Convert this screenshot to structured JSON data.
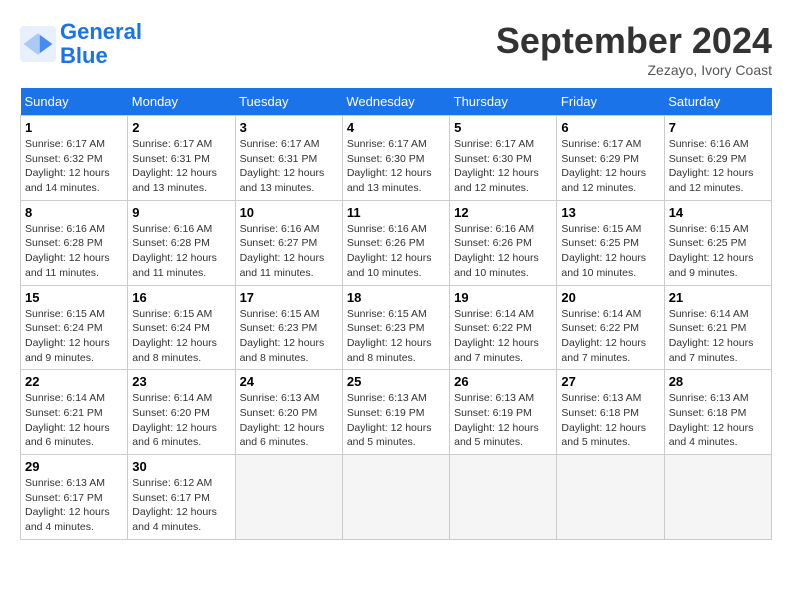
{
  "header": {
    "logo_line1": "General",
    "logo_line2": "Blue",
    "month": "September 2024",
    "location": "Zezayo, Ivory Coast"
  },
  "weekdays": [
    "Sunday",
    "Monday",
    "Tuesday",
    "Wednesday",
    "Thursday",
    "Friday",
    "Saturday"
  ],
  "days": [
    {
      "date": "",
      "info": ""
    },
    {
      "date": "",
      "info": ""
    },
    {
      "date": "",
      "info": ""
    },
    {
      "date": "",
      "info": ""
    },
    {
      "date": "",
      "info": ""
    },
    {
      "date": "",
      "info": ""
    },
    {
      "date": "1",
      "info": "Sunrise: 6:17 AM\nSunset: 6:32 PM\nDaylight: 12 hours\nand 14 minutes."
    },
    {
      "date": "2",
      "info": "Sunrise: 6:17 AM\nSunset: 6:31 PM\nDaylight: 12 hours\nand 13 minutes."
    },
    {
      "date": "3",
      "info": "Sunrise: 6:17 AM\nSunset: 6:31 PM\nDaylight: 12 hours\nand 13 minutes."
    },
    {
      "date": "4",
      "info": "Sunrise: 6:17 AM\nSunset: 6:30 PM\nDaylight: 12 hours\nand 13 minutes."
    },
    {
      "date": "5",
      "info": "Sunrise: 6:17 AM\nSunset: 6:30 PM\nDaylight: 12 hours\nand 12 minutes."
    },
    {
      "date": "6",
      "info": "Sunrise: 6:17 AM\nSunset: 6:29 PM\nDaylight: 12 hours\nand 12 minutes."
    },
    {
      "date": "7",
      "info": "Sunrise: 6:16 AM\nSunset: 6:29 PM\nDaylight: 12 hours\nand 12 minutes."
    },
    {
      "date": "8",
      "info": "Sunrise: 6:16 AM\nSunset: 6:28 PM\nDaylight: 12 hours\nand 11 minutes."
    },
    {
      "date": "9",
      "info": "Sunrise: 6:16 AM\nSunset: 6:28 PM\nDaylight: 12 hours\nand 11 minutes."
    },
    {
      "date": "10",
      "info": "Sunrise: 6:16 AM\nSunset: 6:27 PM\nDaylight: 12 hours\nand 11 minutes."
    },
    {
      "date": "11",
      "info": "Sunrise: 6:16 AM\nSunset: 6:26 PM\nDaylight: 12 hours\nand 10 minutes."
    },
    {
      "date": "12",
      "info": "Sunrise: 6:16 AM\nSunset: 6:26 PM\nDaylight: 12 hours\nand 10 minutes."
    },
    {
      "date": "13",
      "info": "Sunrise: 6:15 AM\nSunset: 6:25 PM\nDaylight: 12 hours\nand 10 minutes."
    },
    {
      "date": "14",
      "info": "Sunrise: 6:15 AM\nSunset: 6:25 PM\nDaylight: 12 hours\nand 9 minutes."
    },
    {
      "date": "15",
      "info": "Sunrise: 6:15 AM\nSunset: 6:24 PM\nDaylight: 12 hours\nand 9 minutes."
    },
    {
      "date": "16",
      "info": "Sunrise: 6:15 AM\nSunset: 6:24 PM\nDaylight: 12 hours\nand 8 minutes."
    },
    {
      "date": "17",
      "info": "Sunrise: 6:15 AM\nSunset: 6:23 PM\nDaylight: 12 hours\nand 8 minutes."
    },
    {
      "date": "18",
      "info": "Sunrise: 6:15 AM\nSunset: 6:23 PM\nDaylight: 12 hours\nand 8 minutes."
    },
    {
      "date": "19",
      "info": "Sunrise: 6:14 AM\nSunset: 6:22 PM\nDaylight: 12 hours\nand 7 minutes."
    },
    {
      "date": "20",
      "info": "Sunrise: 6:14 AM\nSunset: 6:22 PM\nDaylight: 12 hours\nand 7 minutes."
    },
    {
      "date": "21",
      "info": "Sunrise: 6:14 AM\nSunset: 6:21 PM\nDaylight: 12 hours\nand 7 minutes."
    },
    {
      "date": "22",
      "info": "Sunrise: 6:14 AM\nSunset: 6:21 PM\nDaylight: 12 hours\nand 6 minutes."
    },
    {
      "date": "23",
      "info": "Sunrise: 6:14 AM\nSunset: 6:20 PM\nDaylight: 12 hours\nand 6 minutes."
    },
    {
      "date": "24",
      "info": "Sunrise: 6:13 AM\nSunset: 6:20 PM\nDaylight: 12 hours\nand 6 minutes."
    },
    {
      "date": "25",
      "info": "Sunrise: 6:13 AM\nSunset: 6:19 PM\nDaylight: 12 hours\nand 5 minutes."
    },
    {
      "date": "26",
      "info": "Sunrise: 6:13 AM\nSunset: 6:19 PM\nDaylight: 12 hours\nand 5 minutes."
    },
    {
      "date": "27",
      "info": "Sunrise: 6:13 AM\nSunset: 6:18 PM\nDaylight: 12 hours\nand 5 minutes."
    },
    {
      "date": "28",
      "info": "Sunrise: 6:13 AM\nSunset: 6:18 PM\nDaylight: 12 hours\nand 4 minutes."
    },
    {
      "date": "29",
      "info": "Sunrise: 6:13 AM\nSunset: 6:17 PM\nDaylight: 12 hours\nand 4 minutes."
    },
    {
      "date": "30",
      "info": "Sunrise: 6:12 AM\nSunset: 6:17 PM\nDaylight: 12 hours\nand 4 minutes."
    },
    {
      "date": "",
      "info": ""
    },
    {
      "date": "",
      "info": ""
    },
    {
      "date": "",
      "info": ""
    },
    {
      "date": "",
      "info": ""
    },
    {
      "date": "",
      "info": ""
    }
  ]
}
